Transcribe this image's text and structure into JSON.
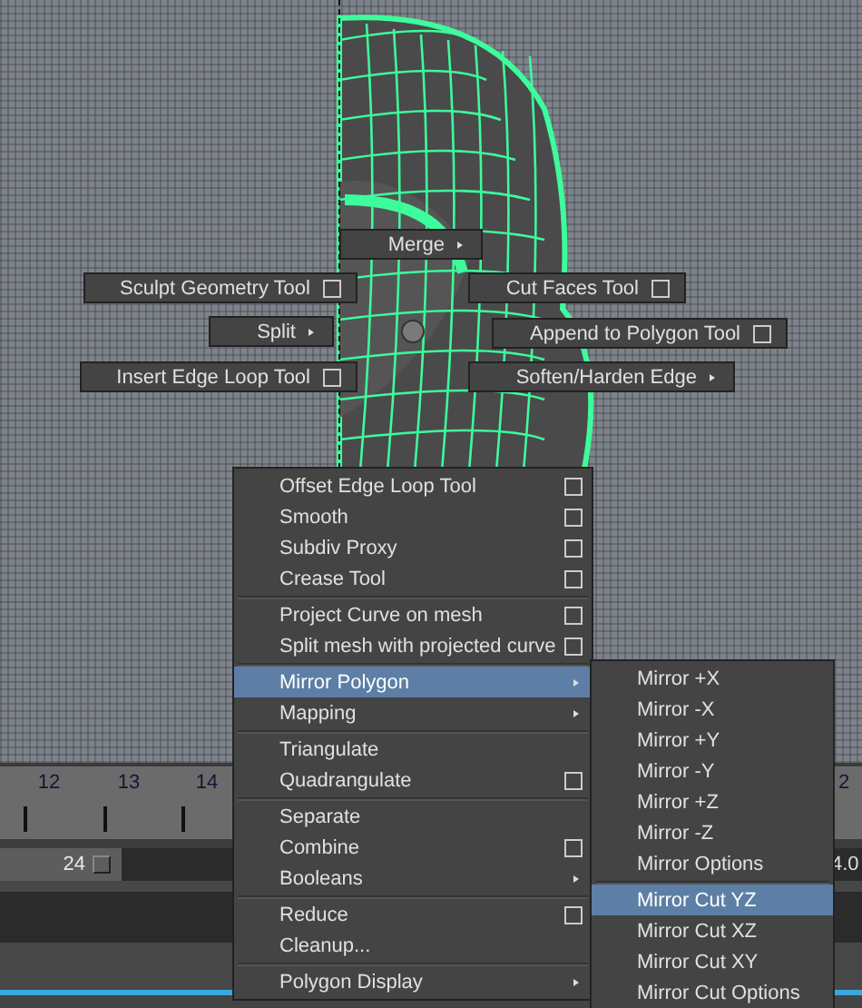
{
  "marking_menu": [
    {
      "label": "Merge",
      "kind": "submenu"
    },
    {
      "label": "Sculpt Geometry Tool",
      "kind": "option"
    },
    {
      "label": "Cut Faces Tool",
      "kind": "option"
    },
    {
      "label": "Split",
      "kind": "submenu"
    },
    {
      "label": "Append to Polygon Tool",
      "kind": "option"
    },
    {
      "label": "Insert Edge Loop Tool",
      "kind": "option"
    },
    {
      "label": "Soften/Harden Edge",
      "kind": "submenu"
    }
  ],
  "menu": {
    "groups": [
      [
        {
          "label": "Offset Edge Loop Tool",
          "kind": "option",
          "selected": false
        },
        {
          "label": "Smooth",
          "kind": "option",
          "selected": false
        },
        {
          "label": "Subdiv Proxy",
          "kind": "option",
          "selected": false
        },
        {
          "label": "Crease Tool",
          "kind": "option",
          "selected": false
        }
      ],
      [
        {
          "label": "Project Curve on mesh",
          "kind": "option",
          "selected": false
        },
        {
          "label": "Split mesh with projected curve",
          "kind": "option",
          "selected": false
        }
      ],
      [
        {
          "label": "Mirror Polygon",
          "kind": "submenu",
          "selected": true
        },
        {
          "label": "Mapping",
          "kind": "submenu",
          "selected": false
        }
      ],
      [
        {
          "label": "Triangulate",
          "kind": "plain",
          "selected": false
        },
        {
          "label": "Quadrangulate",
          "kind": "option",
          "selected": false
        }
      ],
      [
        {
          "label": "Separate",
          "kind": "plain",
          "selected": false
        },
        {
          "label": "Combine",
          "kind": "option",
          "selected": false
        },
        {
          "label": "Booleans",
          "kind": "submenu",
          "selected": false
        }
      ],
      [
        {
          "label": "Reduce",
          "kind": "option",
          "selected": false
        },
        {
          "label": "Cleanup...",
          "kind": "plain",
          "selected": false
        }
      ],
      [
        {
          "label": "Polygon Display",
          "kind": "submenu",
          "selected": false
        }
      ]
    ]
  },
  "submenu": {
    "groups": [
      [
        {
          "label": "Mirror +X",
          "selected": false
        },
        {
          "label": "Mirror -X",
          "selected": false
        },
        {
          "label": "Mirror +Y",
          "selected": false
        },
        {
          "label": "Mirror -Y",
          "selected": false
        },
        {
          "label": "Mirror +Z",
          "selected": false
        },
        {
          "label": "Mirror -Z",
          "selected": false
        },
        {
          "label": "Mirror Options",
          "selected": false
        }
      ],
      [
        {
          "label": "Mirror Cut YZ",
          "selected": true
        },
        {
          "label": "Mirror Cut XZ",
          "selected": false
        },
        {
          "label": "Mirror Cut XY",
          "selected": false
        },
        {
          "label": "Mirror Cut Options",
          "selected": false
        }
      ]
    ]
  },
  "timeline": {
    "ticks": [
      {
        "label": "12"
      },
      {
        "label": "13"
      },
      {
        "label": "14"
      },
      {
        "label": "2"
      }
    ]
  },
  "range_slider": {
    "end_field": "24",
    "value": "4.0"
  }
}
